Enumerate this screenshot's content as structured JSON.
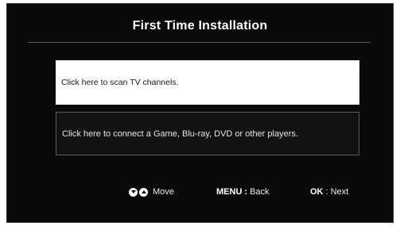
{
  "title": "First Time Installation",
  "options": [
    {
      "label": "Click here to scan TV channels.",
      "selected": true
    },
    {
      "label": "Click here to connect a Game, Blu-ray, DVD or other players.",
      "selected": false
    }
  ],
  "hints": {
    "move": {
      "icons": [
        "arrow-down-icon",
        "arrow-up-icon"
      ],
      "label": "Move"
    },
    "back": {
      "key": "MENU",
      "separator": ":",
      "label": "Back"
    },
    "next": {
      "key": "OK",
      "separator": ":",
      "label": "Next"
    }
  },
  "colors": {
    "background": "#0a0a0a",
    "text": "#ffffff",
    "selected_background": "#ffffff",
    "divider": "#5a5a5a"
  }
}
